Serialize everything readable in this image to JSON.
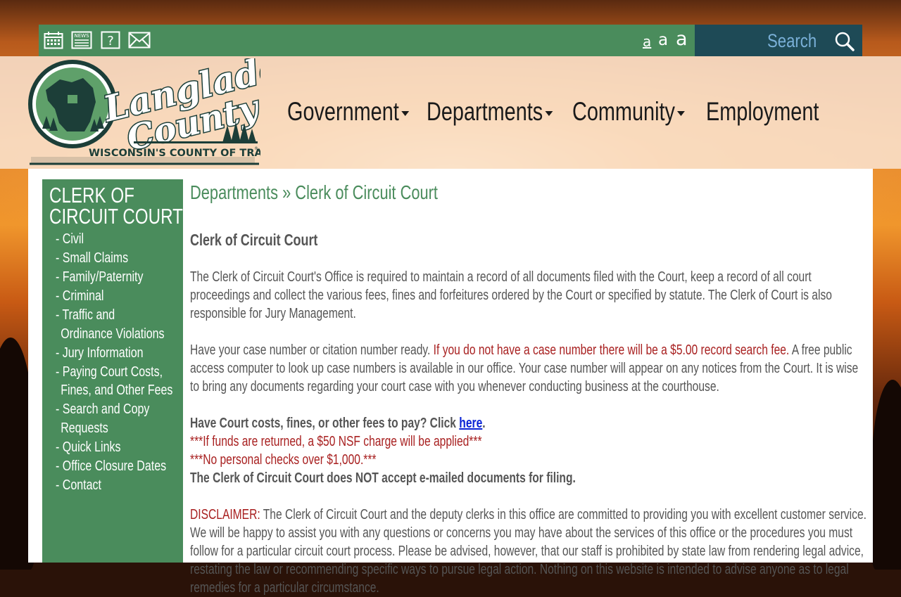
{
  "top_bar": {
    "icons": [
      "calendar-icon",
      "news-icon",
      "help-icon",
      "mail-icon"
    ],
    "news_label": "NEWS",
    "help_symbol": "?",
    "text_sizes": [
      "a",
      "a",
      "a"
    ],
    "search_placeholder": "Search"
  },
  "logo": {
    "line1": "Langlade",
    "line2": "County",
    "tagline": "WISCONSIN'S COUNTY OF TRAILS",
    "trademark": "®"
  },
  "nav": {
    "items": [
      {
        "label": "Government",
        "has_dropdown": true
      },
      {
        "label": "Departments",
        "has_dropdown": true
      },
      {
        "label": "Community",
        "has_dropdown": true
      },
      {
        "label": "Employment",
        "has_dropdown": false
      }
    ]
  },
  "sidebar": {
    "title": "CLERK OF CIRCUIT COURT",
    "items": [
      "- Civil",
      "- Small Claims",
      "- Family/Paternity",
      "- Criminal",
      "- Traffic and Ordinance Violations",
      "- Jury Information",
      "- Paying Court Costs, Fines, and Other Fees",
      "- Search and Copy Requests",
      "- Quick Links",
      "- Office Closure Dates",
      "- Contact"
    ]
  },
  "main": {
    "breadcrumb": "Departments » Clerk of Circuit Court",
    "heading": "Clerk of Circuit Court",
    "intro": "The Clerk of Circuit Court's Office is required to maintain a record of all documents filed with the Court, keep a record of all court proceedings and collect the various fees, fines and forfeitures ordered by the Court or specified by statute.  The Clerk of Court is also responsible for Jury Management.",
    "case_number_lead": "Have your case number or citation number ready.  ",
    "case_number_fee": "If you do not have a case number there will be a $5.00 record search fee.",
    "case_number_rest": " A free public access computer to look up case numbers is available in our office.  Your case number will appear on any notices from the Court.  It is wise to bring any documents regarding your court case with you whenever conducting business at the courthouse.",
    "pay_lead": "Have Court costs, fines, or other fees to pay? Click ",
    "pay_link": "here",
    "pay_end": ".",
    "nsf_note": "***If funds are returned, a $50 NSF charge will be applied***",
    "checks_note": "***No personal checks over $1,000.***",
    "email_note": "The Clerk of Circuit Court does NOT accept e-mailed documents for filing.",
    "disclaimer_label": "DISCLAIMER:",
    "disclaimer_text": "  The Clerk of Circuit Court and the deputy clerks in this office are committed to providing you with excellent customer service. We will be happy to assist you with any questions or concerns you may have about the services of this office or the procedures you must follow for a particular circuit court process. Please be advised, however, that our staff is prohibited by state law from rendering legal advice, restating the law or recommending specific ways to pursue legal action. Nothing on this website is intended to advise anyone as to legal remedies for a particular circumstance."
  },
  "colors": {
    "green": "#4a8c5c",
    "navy": "#1e4a56",
    "search_text": "#7ab0d8",
    "red_text": "#a82020",
    "link": "#0b24d6"
  }
}
